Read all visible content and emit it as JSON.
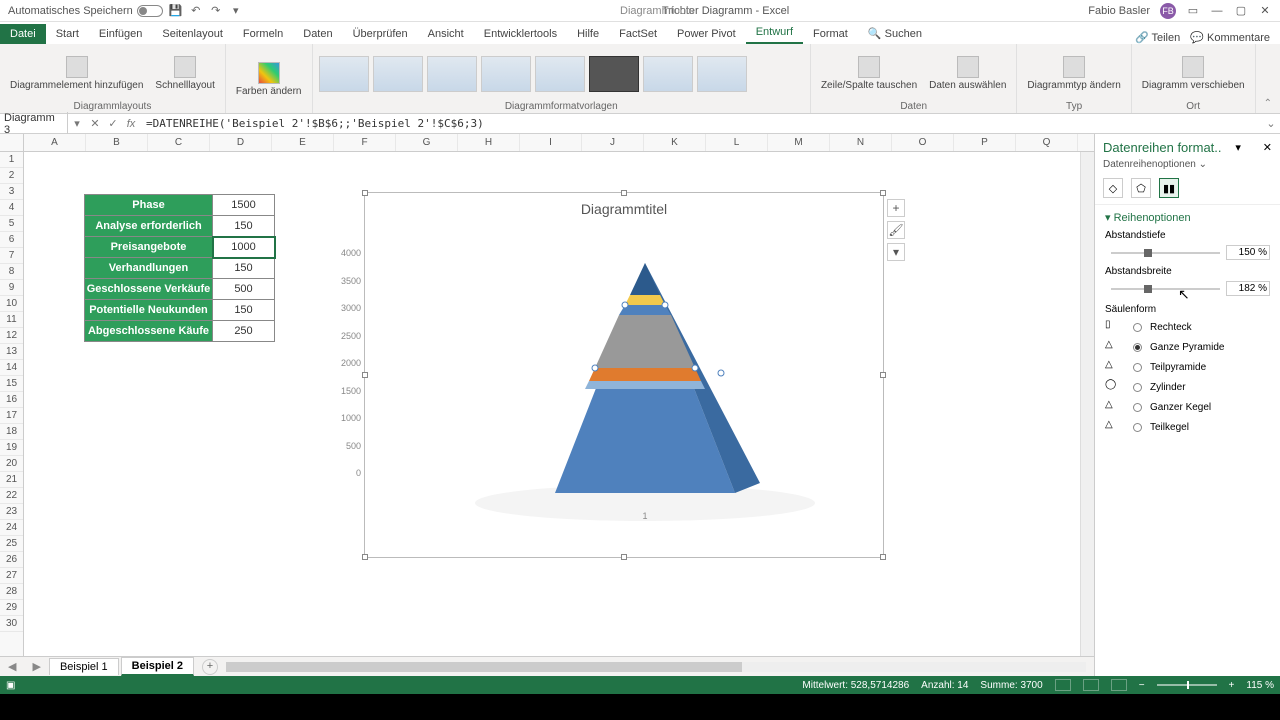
{
  "titlebar": {
    "autosave_label": "Automatisches Speichern",
    "doc_title": "Trichter Diagramm - Excel",
    "tools_label": "Diagrammtools",
    "user_name": "Fabio Basler",
    "user_initials": "FB"
  },
  "tabs": {
    "file": "Datei",
    "items": [
      "Start",
      "Einfügen",
      "Seitenlayout",
      "Formeln",
      "Daten",
      "Überprüfen",
      "Ansicht",
      "Entwicklertools",
      "Hilfe",
      "FactSet",
      "Power Pivot"
    ],
    "context": [
      "Entwurf",
      "Format"
    ],
    "search": "Suchen",
    "share": "Teilen",
    "comments": "Kommentare"
  },
  "ribbon": {
    "g1_btn1": "Diagrammelement hinzufügen",
    "g1_btn2": "Schnelllayout",
    "g1_label": "Diagrammlayouts",
    "g2_btn": "Farben ändern",
    "g2_label": "",
    "g3_label": "Diagrammformatvorlagen",
    "g4_btn1": "Zeile/Spalte tauschen",
    "g4_btn2": "Daten auswählen",
    "g4_label": "Daten",
    "g5_btn": "Diagrammtyp ändern",
    "g5_label": "Typ",
    "g6_btn": "Diagramm verschieben",
    "g6_label": "Ort"
  },
  "formula": {
    "name_box": "Diagramm 3",
    "fx_label": "fx",
    "value": "=DATENREIHE('Beispiel 2'!$B$6;;'Beispiel 2'!$C$6;3)"
  },
  "columns": [
    "A",
    "B",
    "C",
    "D",
    "E",
    "F",
    "G",
    "H",
    "I",
    "J",
    "K",
    "L",
    "M",
    "N",
    "O",
    "P",
    "Q"
  ],
  "table": {
    "rows": [
      {
        "label": "Phase",
        "value": "1500"
      },
      {
        "label": "Analyse erforderlich",
        "value": "150"
      },
      {
        "label": "Preisangebote",
        "value": "1000"
      },
      {
        "label": "Verhandlungen",
        "value": "150"
      },
      {
        "label": "Geschlossene Verkäufe",
        "value": "500"
      },
      {
        "label": "Potentielle Neukunden",
        "value": "150"
      },
      {
        "label": "Abgeschlossene Käufe",
        "value": "250"
      }
    ],
    "selected_row": 2
  },
  "chart": {
    "title": "Diagrammtitel",
    "x_tick": "1",
    "y_ticks": [
      "4000",
      "3500",
      "3000",
      "2500",
      "2000",
      "1500",
      "1000",
      "500",
      "0"
    ]
  },
  "chart_data": {
    "type": "bar",
    "title": "Diagrammtitel",
    "categories": [
      "1"
    ],
    "series": [
      {
        "name": "Phase",
        "values": [
          1500
        ]
      },
      {
        "name": "Analyse erforderlich",
        "values": [
          150
        ]
      },
      {
        "name": "Preisangebote",
        "values": [
          1000
        ]
      },
      {
        "name": "Verhandlungen",
        "values": [
          150
        ]
      },
      {
        "name": "Geschlossene Verkäufe",
        "values": [
          500
        ]
      },
      {
        "name": "Potentielle Neukunden",
        "values": [
          150
        ]
      },
      {
        "name": "Abgeschlossene Käufe",
        "values": [
          250
        ]
      }
    ],
    "ylabel": "",
    "xlabel": "",
    "ylim": [
      0,
      4000
    ]
  },
  "format_pane": {
    "title": "Datenreihen format..",
    "subtitle": "Datenreihenoptionen",
    "section": "Reihenoptionen",
    "gap_depth_label": "Abstandstiefe",
    "gap_depth_value": "150 %",
    "gap_width_label": "Abstandsbreite",
    "gap_width_value": "182 %",
    "shape_label": "Säulenform",
    "shapes": [
      {
        "label": "Rechteck",
        "selected": false
      },
      {
        "label": "Ganze Pyramide",
        "selected": true
      },
      {
        "label": "Teilpyramide",
        "selected": false
      },
      {
        "label": "Zylinder",
        "selected": false
      },
      {
        "label": "Ganzer Kegel",
        "selected": false
      },
      {
        "label": "Teilkegel",
        "selected": false
      }
    ]
  },
  "sheets": {
    "items": [
      "Beispiel 1",
      "Beispiel 2"
    ],
    "active": 1
  },
  "statusbar": {
    "avg_label": "Mittelwert:",
    "avg": "528,5714286",
    "count_label": "Anzahl:",
    "count": "14",
    "sum_label": "Summe:",
    "sum": "3700",
    "zoom": "115 %"
  }
}
